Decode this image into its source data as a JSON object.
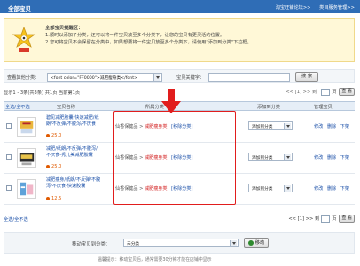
{
  "header": {
    "title": "全部宝贝",
    "link_help": "淘宝旺铺论坛>>",
    "link_category": "类目服务管理>>"
  },
  "tip": {
    "title": "全部宝贝提醒区：",
    "line1": "1.顺时以添加子分类，还可以将一件宝贝放至多个分类下，让您的宝贝有更灵活的位置。",
    "line2": "2.您可将宝贝不会保留在分类中，如果想要将一件宝贝放至多个分类下，请使用\"添加到分类\"下拉框。"
  },
  "search": {
    "category_label": "查看其他分类：",
    "category_value": "<font color=\"FF0000\">减肥瘦身类</font>",
    "keyword_label": "宝贝关键字：",
    "keyword_value": "",
    "search_button": "搜 索"
  },
  "info": {
    "summary": "显示1 - 3条(共3条) 共1页 当前第1页",
    "pager_text": "<< [1] >> 到",
    "page_suffix": "页",
    "go_button": "查 看"
  },
  "table": {
    "col_select": "全选/全不选",
    "col_name": "宝贝名称",
    "col_category": "所属分类",
    "col_add": "添加到分类",
    "col_manage": "管理宝贝",
    "rows": [
      {
        "name": "碧见减肥胶囊-快速减肥/纸朗/不反弹/不腹泻/不厌食",
        "price": "25.0",
        "cat_parent": "仙香保健品",
        "cat_child": "减肥瘦身类",
        "remove": "[移除分类]",
        "add_select": "添加到分类",
        "op_edit": "修改",
        "op_delete": "删除",
        "op_offshelf": "下架"
      },
      {
        "name": "减肥/纸朗/不反弹/不腹泻/不厌食-秀儿美减肥胶囊",
        "price": "25.0",
        "cat_parent": "仙香保健品",
        "cat_child": "减肥瘦身类",
        "remove": "[移除分类]",
        "add_select": "添加到分类",
        "op_edit": "修改",
        "op_delete": "删除",
        "op_offshelf": "下架"
      },
      {
        "name": "减肥瘦身/纸朗/不反弹/不腹泻/不厌食-快速胶囊",
        "price": "12.5",
        "cat_parent": "仙香保健品",
        "cat_child": "减肥瘦身类",
        "remove": "[移除分类]",
        "add_select": "添加到分类",
        "op_edit": "修改",
        "op_delete": "删除",
        "op_offshelf": "下架"
      }
    ]
  },
  "footer": {
    "select_all": "全选/全不选",
    "pager_text": "<< [1] >> 到",
    "page_suffix": "页",
    "go_button": "查 看"
  },
  "move": {
    "label": "移动宝贝到分类：",
    "select_value": "未分类",
    "button": "移动",
    "hint": "温馨提示：移动宝贝后，通常需要30分钟才能在店铺中显示"
  },
  "colors": {
    "header_bg": "#2f6db6",
    "tip_bg": "#fff8d7",
    "highlight": "#e11d1d",
    "link": "#1a4fa8"
  }
}
